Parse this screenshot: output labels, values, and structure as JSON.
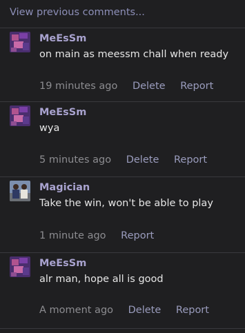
{
  "view_previous": "View previous comments...",
  "comments": [
    {
      "author": "MeEsSm",
      "text": "on main as meessm chall when ready",
      "time": "19 minutes ago",
      "delete": "Delete",
      "report": "Report",
      "avatar": "purple-avatar"
    },
    {
      "author": "MeEsSm",
      "text": "wya",
      "time": "5 minutes ago",
      "delete": "Delete",
      "report": "Report",
      "avatar": "purple-avatar"
    },
    {
      "author": "Magician",
      "text": "Take the win, won't be able to play",
      "time": "1 minute ago",
      "report": "Report",
      "avatar": "people-photo-avatar"
    },
    {
      "author": "MeEsSm",
      "text": "alr man, hope all is good",
      "time": "A moment ago",
      "delete": "Delete",
      "report": "Report",
      "avatar": "purple-avatar"
    }
  ]
}
